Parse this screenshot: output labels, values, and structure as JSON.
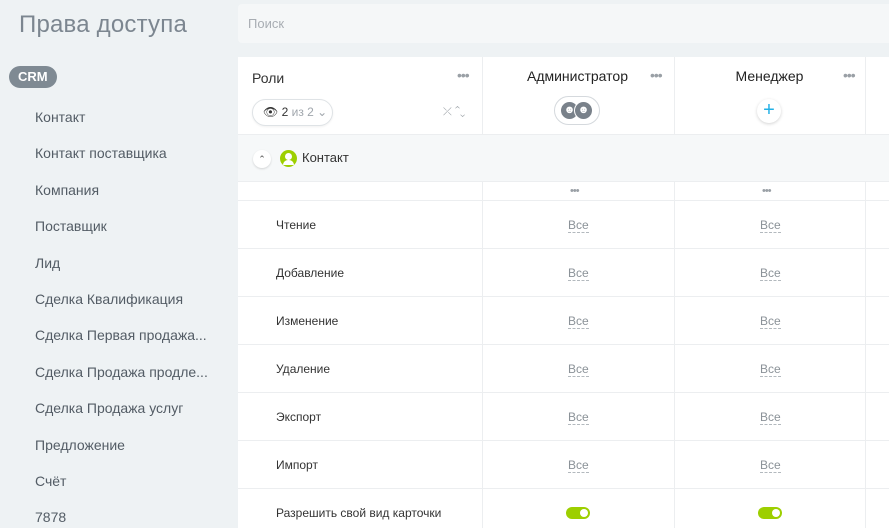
{
  "page": {
    "title": "Права доступа"
  },
  "sidebar": {
    "badge": "CRM",
    "items": [
      {
        "label": "Контакт"
      },
      {
        "label": "Контакт поставщика"
      },
      {
        "label": "Компания"
      },
      {
        "label": "Поставщик"
      },
      {
        "label": "Лид"
      },
      {
        "label": "Сделка Квалификация"
      },
      {
        "label": "Сделка Первая продажа..."
      },
      {
        "label": "Сделка Продажа продле..."
      },
      {
        "label": "Сделка Продажа услуг"
      },
      {
        "label": "Предложение"
      },
      {
        "label": "Счёт"
      },
      {
        "label": "7878"
      }
    ]
  },
  "search": {
    "placeholder": "Поиск",
    "value": ""
  },
  "table": {
    "roles_title": "Роли",
    "filter": {
      "shown": "2",
      "of_text": "из 2"
    },
    "roles": [
      {
        "name": "Администратор"
      },
      {
        "name": "Менеджер"
      }
    ],
    "section": {
      "name": "Контакт"
    },
    "rows": [
      {
        "label": "Чтение",
        "values": [
          "Все",
          "Все"
        ]
      },
      {
        "label": "Добавление",
        "values": [
          "Все",
          "Все"
        ]
      },
      {
        "label": "Изменение",
        "values": [
          "Все",
          "Все"
        ]
      },
      {
        "label": "Удаление",
        "values": [
          "Все",
          "Все"
        ]
      },
      {
        "label": "Экспорт",
        "values": [
          "Все",
          "Все"
        ]
      },
      {
        "label": "Импорт",
        "values": [
          "Все",
          "Все"
        ]
      },
      {
        "label": "Разрешить свой вид карточки",
        "toggles": [
          true,
          true
        ]
      }
    ]
  },
  "colors": {
    "accent_green": "#9dcf00",
    "add_blue": "#21b0e6",
    "badge": "#7f8a93"
  },
  "icons": [
    "eye-icon",
    "chevron-down-icon",
    "collapse-icon",
    "more-icon",
    "add-icon",
    "chevron-up-icon",
    "contact-icon"
  ]
}
